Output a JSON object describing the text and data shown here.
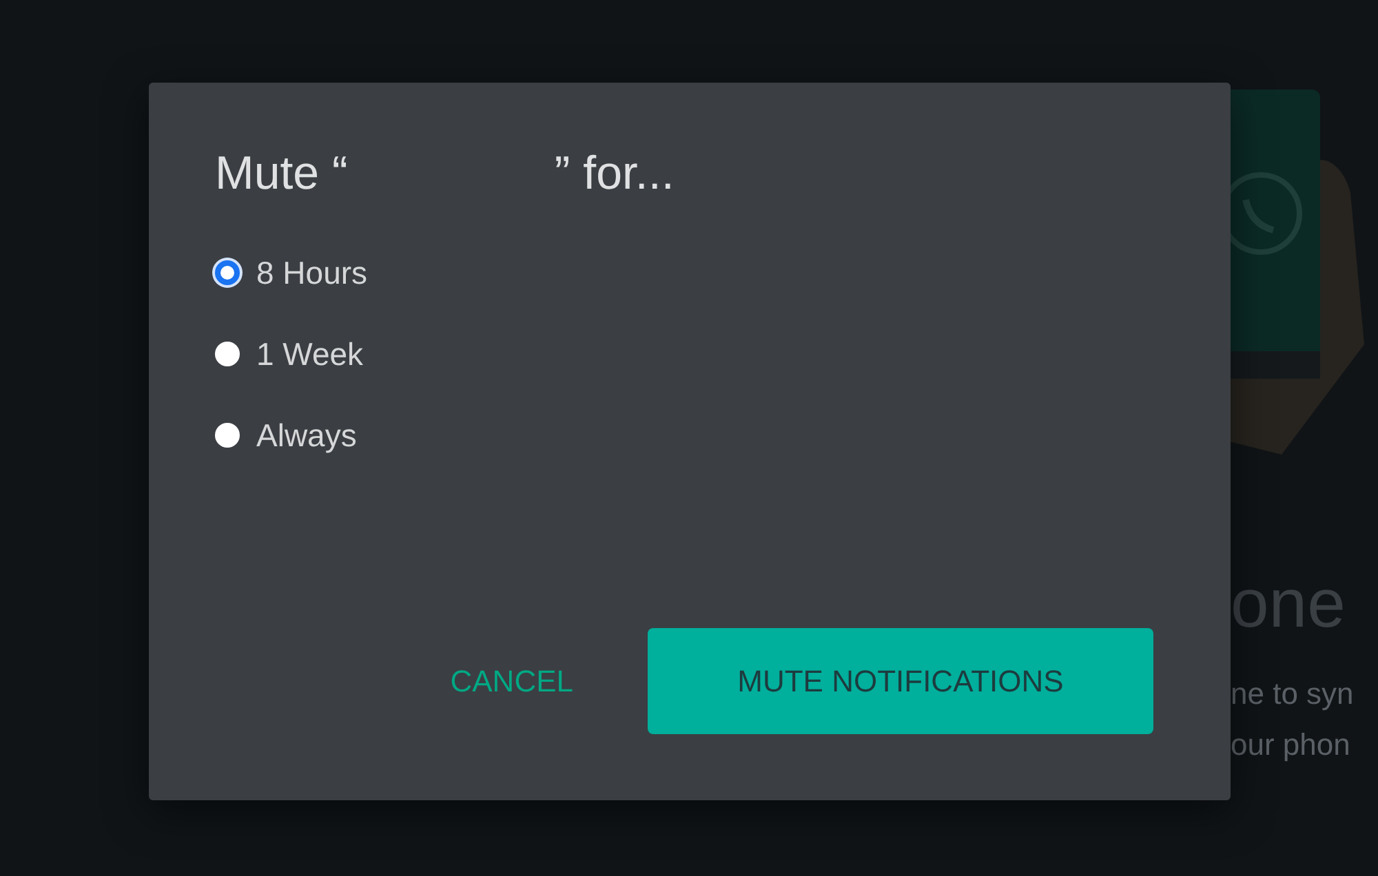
{
  "background": {
    "heading": "one",
    "lines": [
      "ne to syn",
      "our phon"
    ]
  },
  "dialog": {
    "title_start": "Mute “",
    "title_end": "” for...",
    "options": [
      {
        "label": "8 Hours",
        "selected": true
      },
      {
        "label": "1 Week",
        "selected": false
      },
      {
        "label": "Always",
        "selected": false
      }
    ],
    "buttons": [
      {
        "label": "CANCEL",
        "kind": "text"
      },
      {
        "label": "MUTE NOTIFICATIONS",
        "kind": "filled"
      }
    ]
  }
}
